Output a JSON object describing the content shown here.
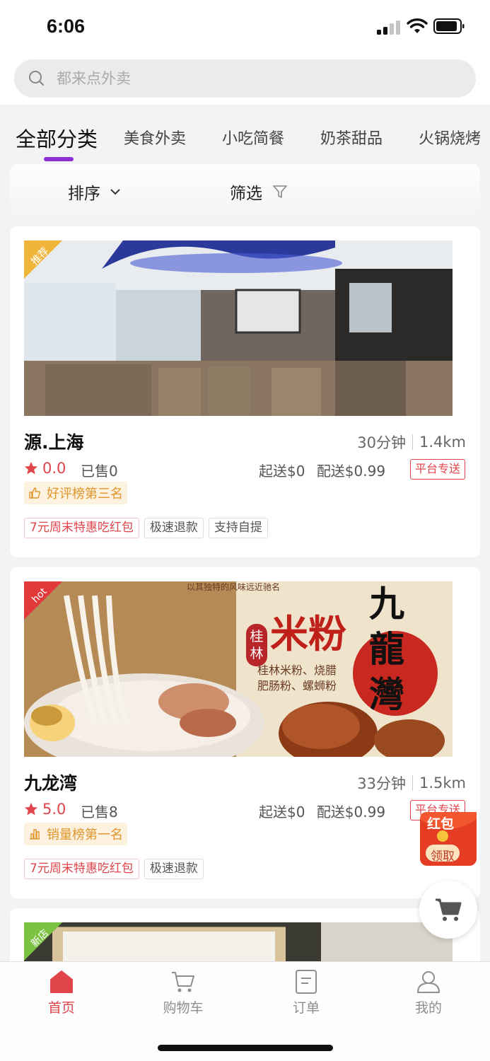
{
  "status": {
    "time": "6:06"
  },
  "search": {
    "placeholder": "都来点外卖"
  },
  "categories": [
    {
      "label": "全部分类",
      "active": true
    },
    {
      "label": "美食外卖"
    },
    {
      "label": "小吃简餐"
    },
    {
      "label": "奶茶甜品"
    },
    {
      "label": "火锅烧烤"
    }
  ],
  "sortbar": {
    "sort_label": "排序",
    "filter_label": "筛选"
  },
  "stores": [
    {
      "corner": "推荐",
      "corner_color": "#f0b43a",
      "name": "源.上海",
      "time": "30分钟",
      "distance": "1.4km",
      "rating": "0.0",
      "sold": "已售0",
      "min_order": "起送$0",
      "delivery_fee": "配送$0.99",
      "platform": "平台专送",
      "rank": "好评榜第三名",
      "rank_icon": "thumbs-up-icon",
      "promos": [
        "7元周末特惠吃红包",
        "极速退款",
        "支持自提"
      ]
    },
    {
      "corner": "hot",
      "corner_color": "#e23a3a",
      "name": "九龙湾",
      "time": "33分钟",
      "distance": "1.5km",
      "rating": "5.0",
      "sold": "已售8",
      "min_order": "起送$0",
      "delivery_fee": "配送$0.99",
      "platform": "平台专送",
      "rank": "销量榜第一名",
      "rank_icon": "bar-chart-icon",
      "promos": [
        "7元周末特惠吃红包",
        "极速退款"
      ],
      "banner": {
        "top_line": "以其独特的风味远近驰名",
        "vertical_tag": "桂林",
        "title": "米粉",
        "items_line1": "桂林米粉、烧腊",
        "items_line2": "肥肠粉、螺蛳粉",
        "brand": "九龍灣"
      }
    },
    {
      "corner": "新店",
      "corner_color": "#7cc242"
    }
  ],
  "redpacket": {
    "title": "红包",
    "action": "领取"
  },
  "tabbar": [
    {
      "label": "首页",
      "icon": "home-icon",
      "active": true
    },
    {
      "label": "购物车",
      "icon": "cart-icon"
    },
    {
      "label": "订单",
      "icon": "order-icon"
    },
    {
      "label": "我的",
      "icon": "profile-icon"
    }
  ],
  "colors": {
    "accent": "#e0454c",
    "purple": "#8e2fd6",
    "rank_bg": "#fdf1e0",
    "rank_text": "#e0962d"
  }
}
